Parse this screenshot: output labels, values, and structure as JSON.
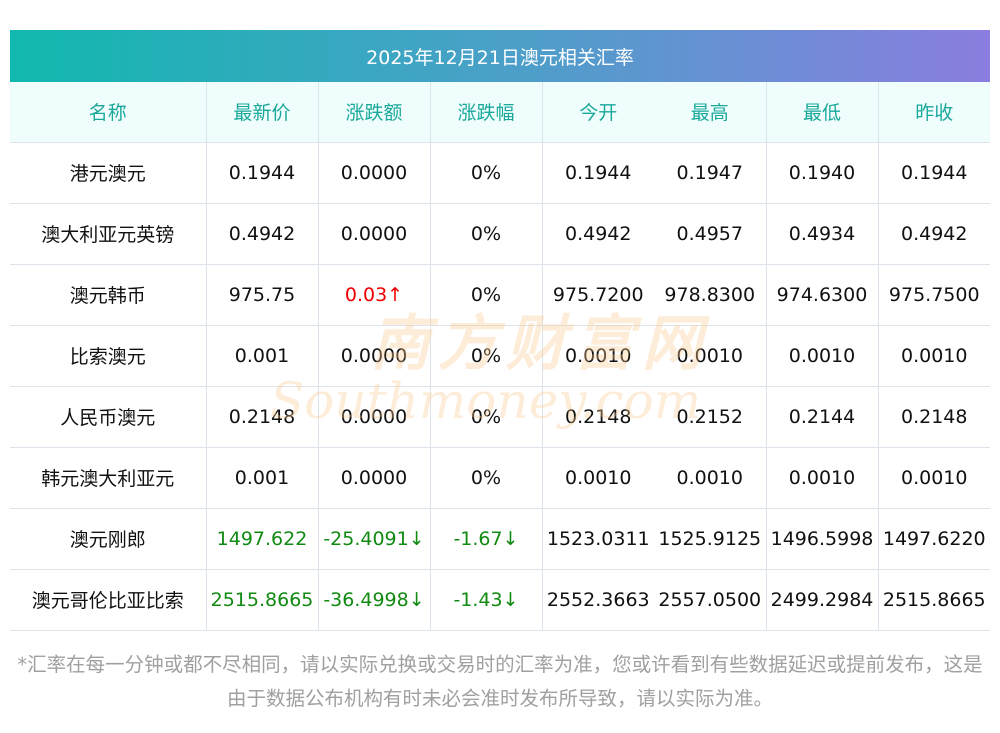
{
  "title": "2025年12月21日澳元相关汇率",
  "headers": [
    "名称",
    "最新价",
    "涨跌额",
    "涨跌幅",
    "今开",
    "最高",
    "最低",
    "昨收"
  ],
  "rows": [
    {
      "name": "港元澳元",
      "price": "0.1944",
      "chg": "0.0000",
      "pct": "0%",
      "open": "0.1944",
      "high": "0.1947",
      "low": "0.1940",
      "prev": "0.1944",
      "trend": "flat"
    },
    {
      "name": "澳大利亚元英镑",
      "price": "0.4942",
      "chg": "0.0000",
      "pct": "0%",
      "open": "0.4942",
      "high": "0.4957",
      "low": "0.4934",
      "prev": "0.4942",
      "trend": "flat"
    },
    {
      "name": "澳元韩币",
      "price": "975.75",
      "chg": "0.03↑",
      "pct": "0%",
      "open": "975.7200",
      "high": "978.8300",
      "low": "974.6300",
      "prev": "975.7500",
      "trend": "up"
    },
    {
      "name": "比索澳元",
      "price": "0.001",
      "chg": "0.0000",
      "pct": "0%",
      "open": "0.0010",
      "high": "0.0010",
      "low": "0.0010",
      "prev": "0.0010",
      "trend": "flat"
    },
    {
      "name": "人民币澳元",
      "price": "0.2148",
      "chg": "0.0000",
      "pct": "0%",
      "open": "0.2148",
      "high": "0.2152",
      "low": "0.2144",
      "prev": "0.2148",
      "trend": "flat"
    },
    {
      "name": "韩元澳大利亚元",
      "price": "0.001",
      "chg": "0.0000",
      "pct": "0%",
      "open": "0.0010",
      "high": "0.0010",
      "low": "0.0010",
      "prev": "0.0010",
      "trend": "flat"
    },
    {
      "name": "澳元刚郎",
      "price": "1497.622",
      "chg": "-25.4091↓",
      "pct": "-1.67↓",
      "open": "1523.0311",
      "high": "1525.9125",
      "low": "1496.5998",
      "prev": "1497.6220",
      "trend": "down"
    },
    {
      "name": "澳元哥伦比亚比索",
      "price": "2515.8665",
      "chg": "-36.4998↓",
      "pct": "-1.43↓",
      "open": "2552.3663",
      "high": "2557.0500",
      "low": "2499.2984",
      "prev": "2515.8665",
      "trend": "down"
    }
  ],
  "note": "*汇率在每一分钟或都不尽相同，请以实际兑换或交易时的汇率为准，您或许看到有些数据延迟或提前发布，这是由于数据公布机构有时未必会准时发布所导致，请以实际为准。",
  "watermark": {
    "cn": "南方财富网",
    "en": "Southmoney.com"
  },
  "colors": {
    "up": "#ee0000",
    "down": "#118a11",
    "header_text": "#1aa89a"
  }
}
